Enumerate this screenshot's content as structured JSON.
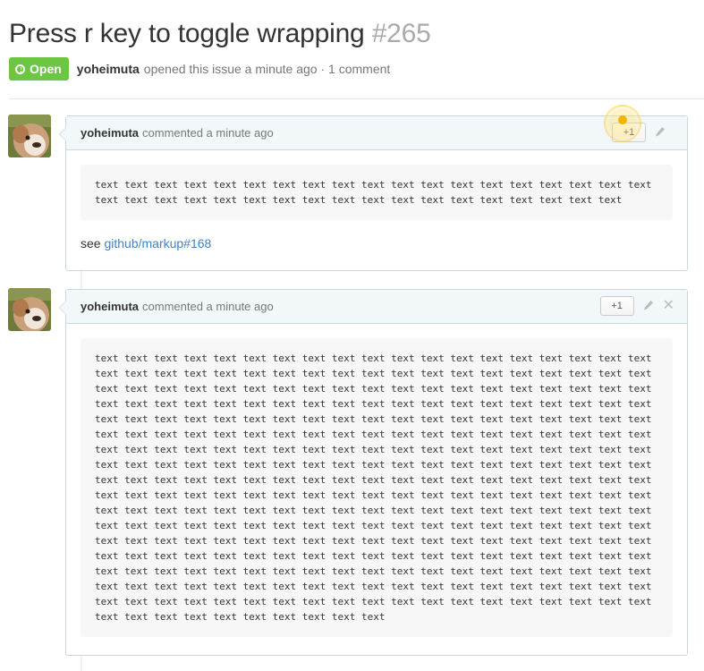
{
  "issue": {
    "title": "Press r key to toggle wrapping",
    "number": "#265",
    "state": "Open",
    "author": "yoheimuta",
    "meta_text": "opened this issue a minute ago · 1 comment"
  },
  "comments": [
    {
      "author": "yoheimuta",
      "time": "commented a minute ago",
      "plusone": "+1",
      "code": "text text text text text text text text text text text text text text text text text text text\ntext text text text text text text text text text text text text text text text text text",
      "see_prefix": "see",
      "link": "github/markup#168"
    },
    {
      "author": "yoheimuta",
      "time": "commented a minute ago",
      "plusone": "+1",
      "code": "text text text text text text text text text text text text text text text text text text text\ntext text text text text text text text text text text text text text text text text text text\ntext text text text text text text text text text text text text text text text text text text\ntext text text text text text text text text text text text text text text text text text text\ntext text text text text text text text text text text text text text text text text text text\ntext text text text text text text text text text text text text text text text text text text\ntext text text text text text text text text text text text text text text text text text text\ntext text text text text text text text text text text text text text text text text text text\ntext text text text text text text text text text text text text text text text text text text\ntext text text text text text text text text text text text text text text text text text text\ntext text text text text text text text text text text text text text text text text text text\ntext text text text text text text text text text text text text text text text text text text\ntext text text text text text text text text text text text text text text text text text text\ntext text text text text text text text text text text text text text text text text text text\ntext text text text text text text text text text text text text text text text text text text\ntext text text text text text text text text text text text text text text text text text text\ntext text text text text text text text text text text text text text text text text text text\ntext text text text text text text text text text"
    }
  ],
  "icons": [
    "alert-circle-icon",
    "pencil-icon",
    "close-icon",
    "avatar-image"
  ],
  "colors": {
    "open": "#6cc644",
    "link": "#4183c4",
    "header_bg": "#f2f8fa",
    "border": "#cad8e0"
  }
}
